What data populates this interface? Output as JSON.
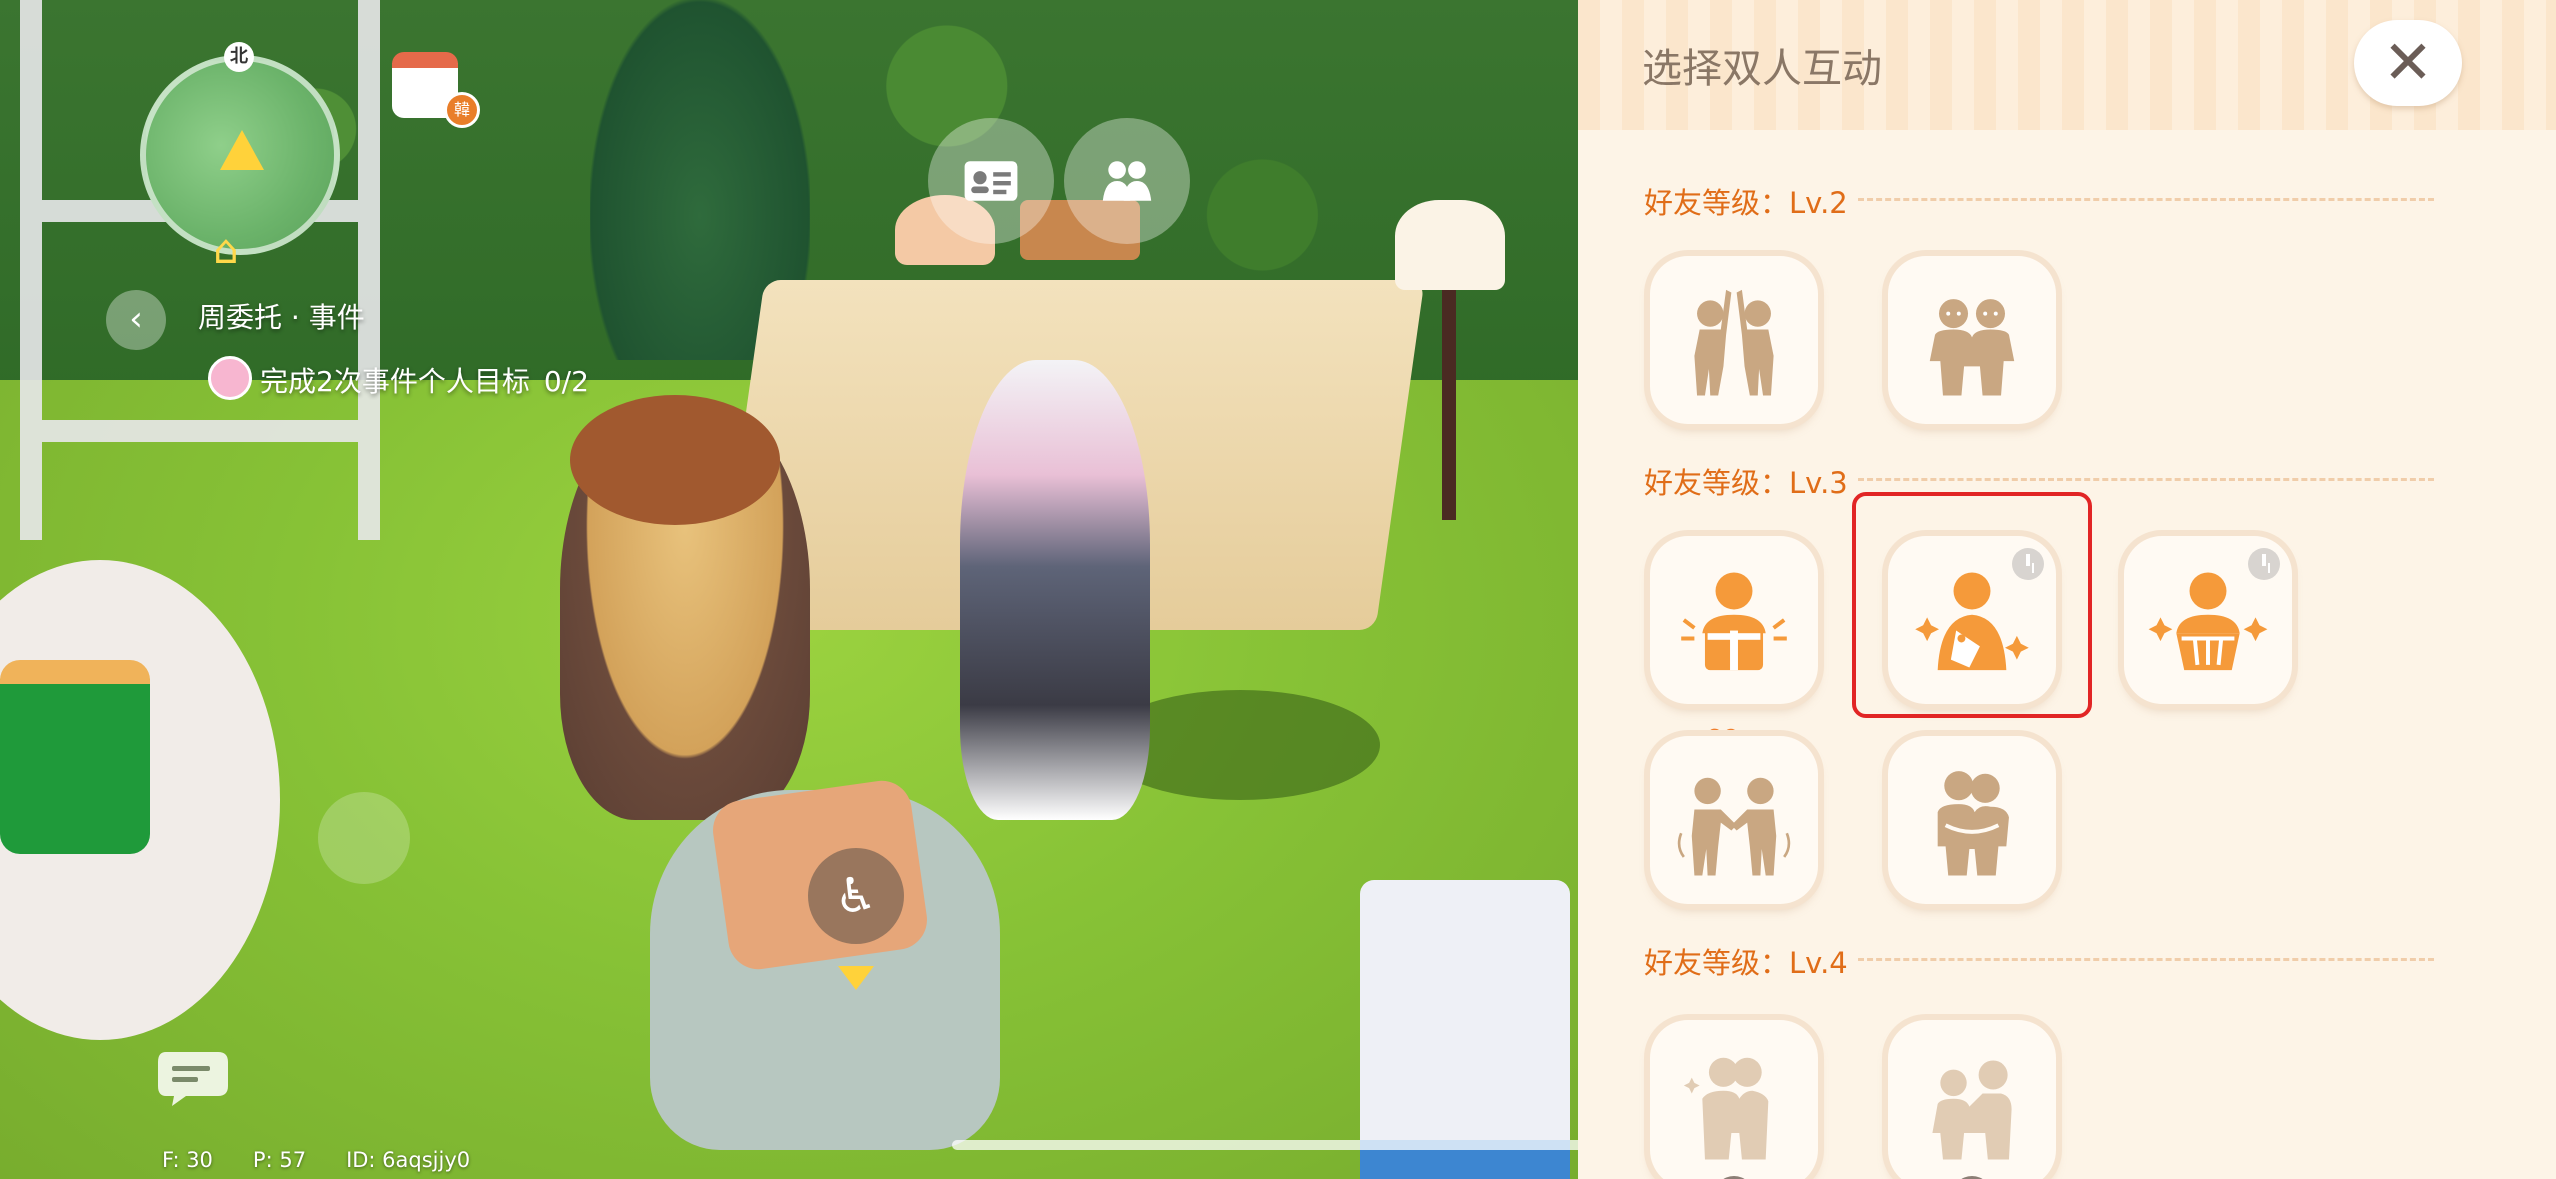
{
  "hud": {
    "minimap_north": "北",
    "quest_title": "周委托 · 事件",
    "quest_goal": "完成2次事件个人目标",
    "quest_progress": "0/2",
    "calendar_badge": "韓",
    "debug": {
      "fps": "F: 30",
      "ping": "P: 57",
      "id": "ID: 6aqsjjy0"
    },
    "icons": {
      "profile": "id-card-icon",
      "friends": "friends-icon",
      "sit": "seat-icon",
      "chat": "chat-bubble-icon"
    }
  },
  "panel": {
    "title": "选择双人互动",
    "close_glyph": "✕",
    "levels": [
      {
        "label": "好友等级：Lv.2",
        "items": [
          "high-five-icon",
          "shoulder-to-shoulder-icon"
        ]
      },
      {
        "label": "好友等级：Lv.3",
        "items": [
          "gift-box-icon",
          "price-tag-icon",
          "basket-icon",
          "handshake-icon",
          "hug-icon"
        ]
      },
      {
        "label": "好友等级：Lv.4",
        "items": [
          "embrace-icon",
          "pat-shoulder-icon"
        ]
      }
    ],
    "colors": {
      "accent": "#e06d18",
      "figure_brown": "#c9a782",
      "figure_orange": "#f59a3a",
      "highlight": "#e12525"
    }
  }
}
